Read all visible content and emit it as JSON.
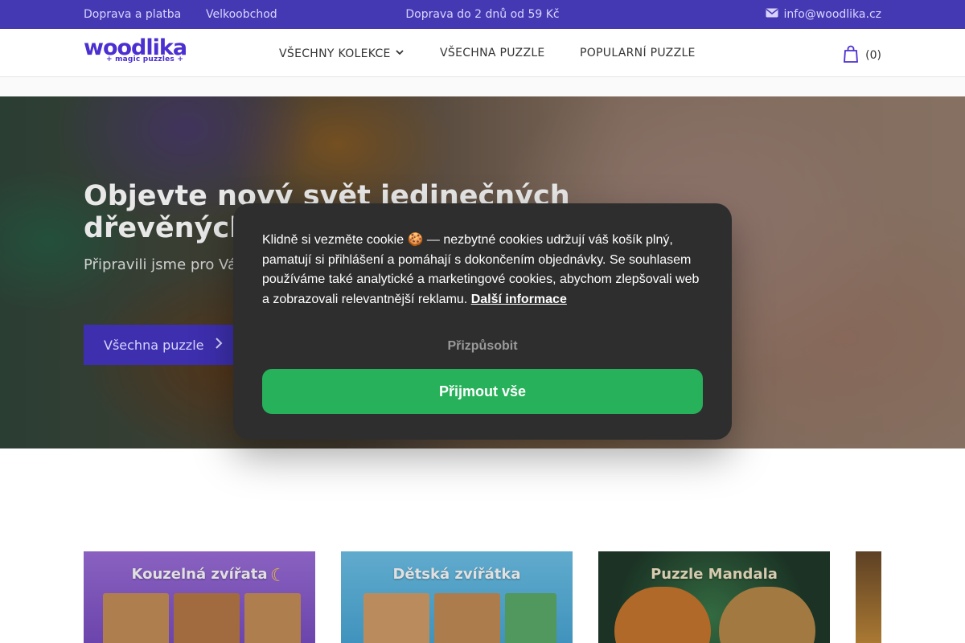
{
  "topbar": {
    "link_shipping": "Doprava a platba",
    "link_wholesale": "Velkoobchod",
    "promo": "Doprava do 2 dnů od 59 Kč",
    "email": "info@woodlika.cz"
  },
  "header": {
    "logo_text": "woodlika",
    "logo_tagline": "+ magic puzzles +",
    "nav": [
      "VŠECHNY KOLEKCE",
      "VŠECHNA PUZZLE",
      "POPULARNÍ PUZZLE"
    ],
    "cart_count": "(0)"
  },
  "hero": {
    "title": "Objevte nový svět jedinečných dřevěných",
    "subtitle": "Připravili jsme pro Vás akvarelovým motiven",
    "button_label": "Všechna puzzle"
  },
  "collections": [
    {
      "title": "Kouzelná zvířata",
      "color": "#8a5fd0"
    },
    {
      "title": "Dětská zvířátka",
      "color": "#5bb6e2"
    },
    {
      "title": "Puzzle Mandala",
      "color": "#2a5a38"
    }
  ],
  "cookie": {
    "text": "Klidně si vezměte cookie 🍪 — nezbytné cookies udržují váš košík plný, pamatují si přihlášení a pomáhají s dokončením objednávky. Se souhlasem používáme také analytické a marketingové cookies, abychom zlepšovali web a zobrazovali relevantnější reklamu.",
    "more_link": "Další informace",
    "customize_label": "Přizpůsobit",
    "accept_label": "Přijmout vše"
  },
  "colors": {
    "brand": "#4539b3",
    "accept": "#27b15a",
    "modal_bg": "#2e2e2e"
  }
}
